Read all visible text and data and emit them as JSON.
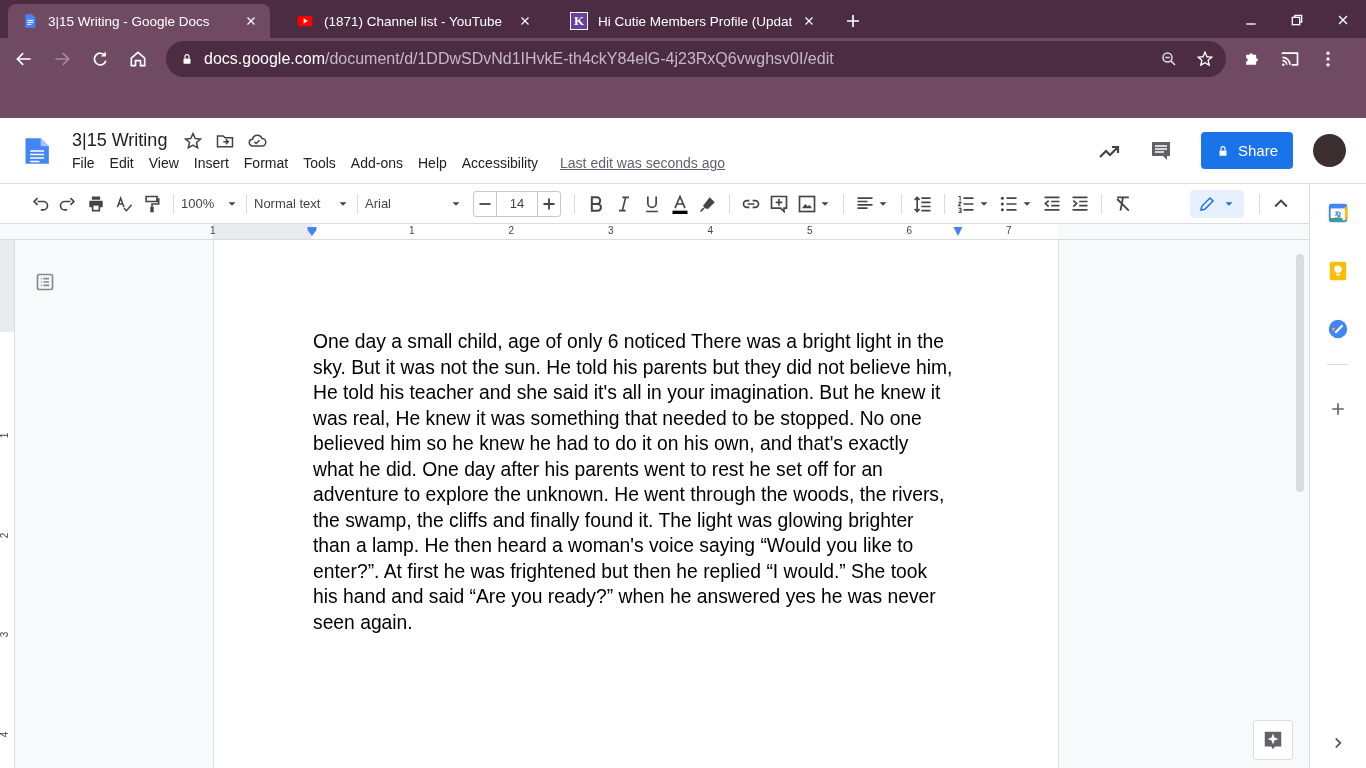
{
  "browser": {
    "tabs": [
      {
        "title": "3|15 Writing - Google Docs",
        "selected": true
      },
      {
        "title": "(1871) Channel list - YouTube",
        "selected": false
      },
      {
        "title": "Hi Cutie Members Profile (Updat",
        "letter": "K",
        "selected": false
      }
    ],
    "url": {
      "host": "docs.google.com",
      "path": "/document/d/1DDwSDvNd1IHvkE-th4ckY84elG-4j23RxQ6vwghsv0I/edit"
    }
  },
  "docs": {
    "title": "3|15 Writing",
    "menu": [
      "File",
      "Edit",
      "View",
      "Insert",
      "Format",
      "Tools",
      "Add-ons",
      "Help",
      "Accessibility"
    ],
    "last_edit": "Last edit was seconds ago",
    "share": "Share"
  },
  "toolbar": {
    "zoom": "100%",
    "style": "Normal text",
    "font": "Arial",
    "size": "14"
  },
  "ruler": {
    "horizontal": [
      "1",
      "1",
      "2",
      "3",
      "4",
      "5",
      "6",
      "7"
    ],
    "vertical": [
      "1",
      "2",
      "3",
      "4"
    ]
  },
  "document": {
    "paragraphs": [
      "One day a small child, age of only 6 noticed There was a bright light in the sky. But it was not the sun. He told his parents but they did not believe him, He told his teacher and she said it's all in your imagination. But he knew it was real, He knew it was something that needed to be stopped. No one believed him so he knew he had to do it on his own, and that's exactly what he did. One day after his parents went to rest he set off for an adventure to explore the unknown. He went through the woods, the rivers, the swamp, the cliffs and finally found it. The light was glowing brighter than a lamp. He then heard a woman's voice saying “Would you like to enter?”. At first he was frightened but then he replied “I would.” She took his hand and said “Are you ready?” when he answered yes he was never seen again."
    ]
  }
}
